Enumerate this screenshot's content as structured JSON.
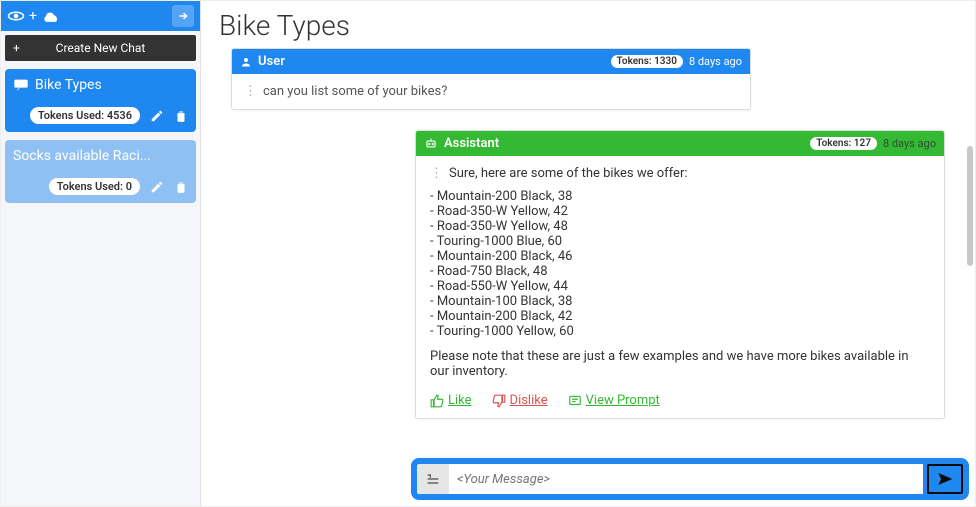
{
  "sidebar": {
    "new_chat_label": "Create New Chat",
    "items": [
      {
        "title": "Bike Types",
        "tokens_label": "Tokens Used: 4536",
        "active": true
      },
      {
        "title": "Socks available Raci...",
        "tokens_label": "Tokens Used: 0",
        "active": false
      }
    ]
  },
  "page_title": "Bike Types",
  "user_message": {
    "role_label": "User",
    "tokens_label": "Tokens: 1330",
    "timestamp": "8 days ago",
    "text": "can you list some of your bikes?"
  },
  "assistant_message": {
    "role_label": "Assistant",
    "tokens_label": "Tokens: 127",
    "timestamp": "8 days ago",
    "intro": "Sure, here are some of the bikes we offer:",
    "bikes": [
      "- Mountain-200 Black, 38",
      "- Road-350-W Yellow, 42",
      "- Road-350-W Yellow, 48",
      "- Touring-1000 Blue, 60",
      "- Mountain-200 Black, 46",
      "- Road-750 Black, 48",
      "- Road-550-W Yellow, 44",
      "- Mountain-100 Black, 38",
      "- Mountain-200 Black, 42",
      "- Touring-1000 Yellow, 60"
    ],
    "note": "Please note that these are just a few examples and we have more bikes available in our inventory.",
    "like_label": "Like",
    "dislike_label": "Dislike",
    "view_prompt_label": "View Prompt"
  },
  "composer": {
    "placeholder": "<Your Message>"
  }
}
